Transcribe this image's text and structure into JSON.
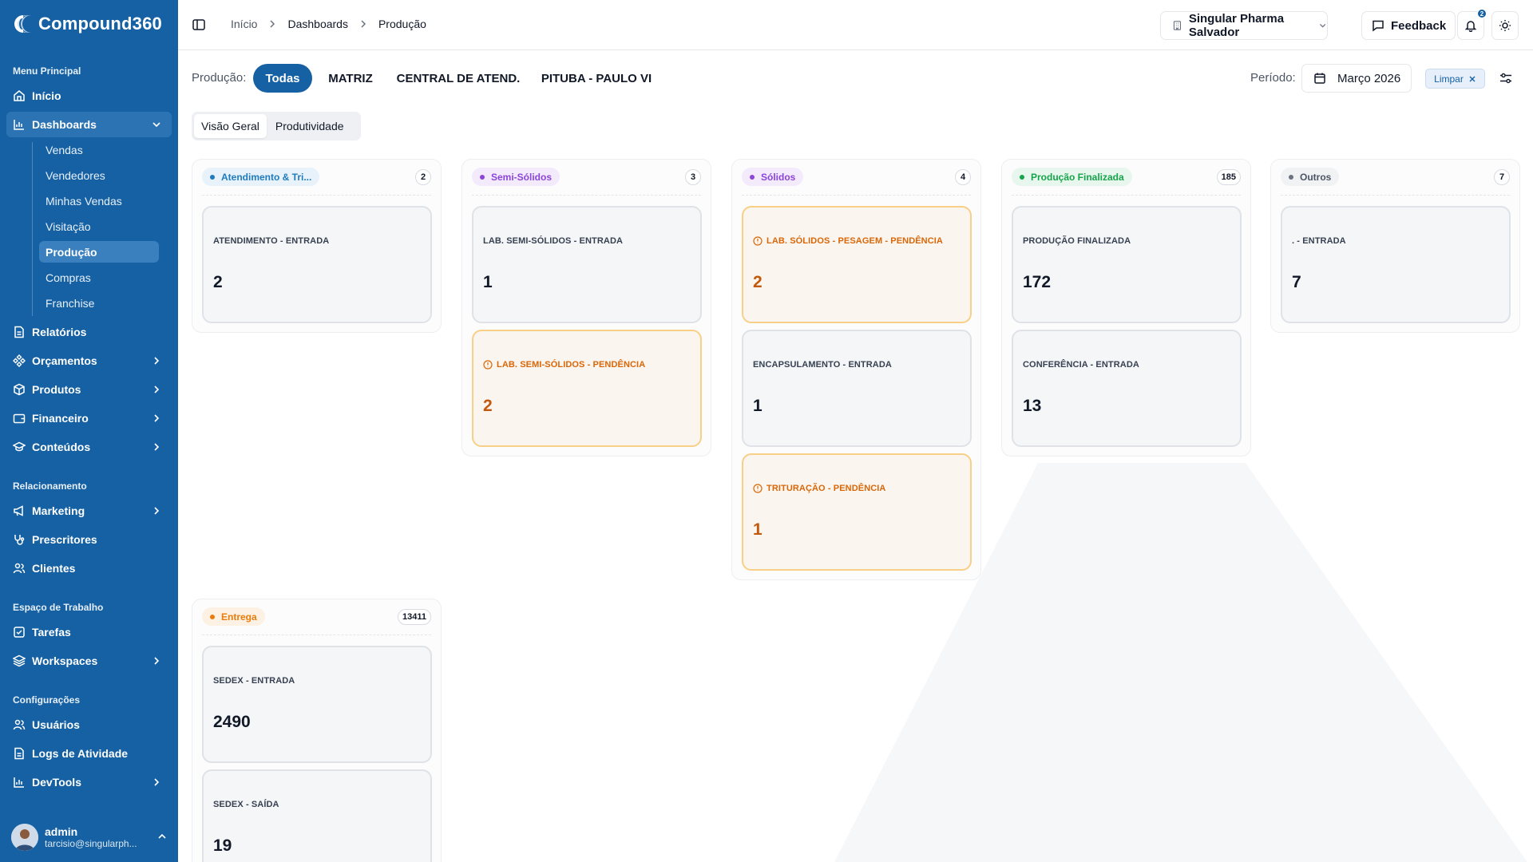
{
  "app": {
    "name": "Compound360"
  },
  "sidebar": {
    "sections": {
      "main": "Menu Principal",
      "relationship": "Relacionamento",
      "workspace": "Espaço de Trabalho",
      "settings": "Configurações"
    },
    "items": {
      "inicio": "Início",
      "dashboards": "Dashboards",
      "relatorios": "Relatórios",
      "orcamentos": "Orçamentos",
      "produtos": "Produtos",
      "financeiro": "Financeiro",
      "conteudos": "Conteúdos",
      "marketing": "Marketing",
      "prescritores": "Prescritores",
      "clientes": "Clientes",
      "tarefas": "Tarefas",
      "workspaces": "Workspaces",
      "usuarios": "Usuários",
      "logs": "Logs de Atividade",
      "devtools": "DevTools"
    },
    "dashboard_sub": [
      "Vendas",
      "Vendedores",
      "Minhas Vendas",
      "Visitação",
      "Produção",
      "Compras",
      "Franchise"
    ],
    "active_sub": "Produção",
    "user": {
      "name": "admin",
      "email": "tarcisio@singularph..."
    }
  },
  "header": {
    "breadcrumb": [
      "Início",
      "Dashboards",
      "Produção"
    ],
    "store": "Singular Pharma Salvador",
    "feedback": "Feedback",
    "notifications": "2"
  },
  "filters": {
    "production_label": "Produção:",
    "chips": [
      "Todas",
      "MATRIZ",
      "CENTRAL DE ATEND.",
      "PITUBA - PAULO VI"
    ],
    "active_chip": "Todas",
    "period_label": "Período:",
    "period_value": "Março 2026",
    "clear_label": "Limpar"
  },
  "tabs": [
    "Visão Geral",
    "Produtividade"
  ],
  "active_tab": "Visão Geral",
  "colors": {
    "brand": "#1561a3",
    "warning": "#d96708",
    "col_blue": "#1f7bbd",
    "col_purple": "#8b45d9",
    "col_green": "#16a34a",
    "col_gray": "#4b5563",
    "col_orange": "#ea7c0c"
  },
  "columns": [
    {
      "title": "Atendimento & Tri...",
      "count": "2",
      "cards": [
        {
          "title": "ATENDIMENTO - ENTRADA",
          "value": "2"
        }
      ]
    },
    {
      "title": "Semi-Sólidos",
      "count": "3",
      "cards": [
        {
          "title": "LAB. SEMI-SÓLIDOS - ENTRADA",
          "value": "1"
        },
        {
          "title": "LAB. SEMI-SÓLIDOS - PENDÊNCIA",
          "value": "2",
          "warning": true
        }
      ]
    },
    {
      "title": "Sólidos",
      "count": "4",
      "cards": [
        {
          "title": "LAB. SÓLIDOS - PESAGEM - PENDÊNCIA",
          "value": "2",
          "warning": true
        },
        {
          "title": "ENCAPSULAMENTO - ENTRADA",
          "value": "1"
        },
        {
          "title": "TRITURAÇÃO - PENDÊNCIA",
          "value": "1",
          "warning": true
        }
      ]
    },
    {
      "title": "Produção Finalizada",
      "count": "185",
      "cards": [
        {
          "title": "PRODUÇÃO FINALIZADA",
          "value": "172"
        },
        {
          "title": "CONFERÊNCIA - ENTRADA",
          "value": "13"
        }
      ]
    },
    {
      "title": "Outros",
      "count": "7",
      "cards": [
        {
          "title": ". - ENTRADA",
          "value": "7"
        }
      ]
    },
    {
      "title": "Entrega",
      "count": "13411",
      "cards": [
        {
          "title": "SEDEX - ENTRADA",
          "value": "2490"
        },
        {
          "title": "SEDEX - SAÍDA",
          "value": "19"
        }
      ]
    }
  ]
}
